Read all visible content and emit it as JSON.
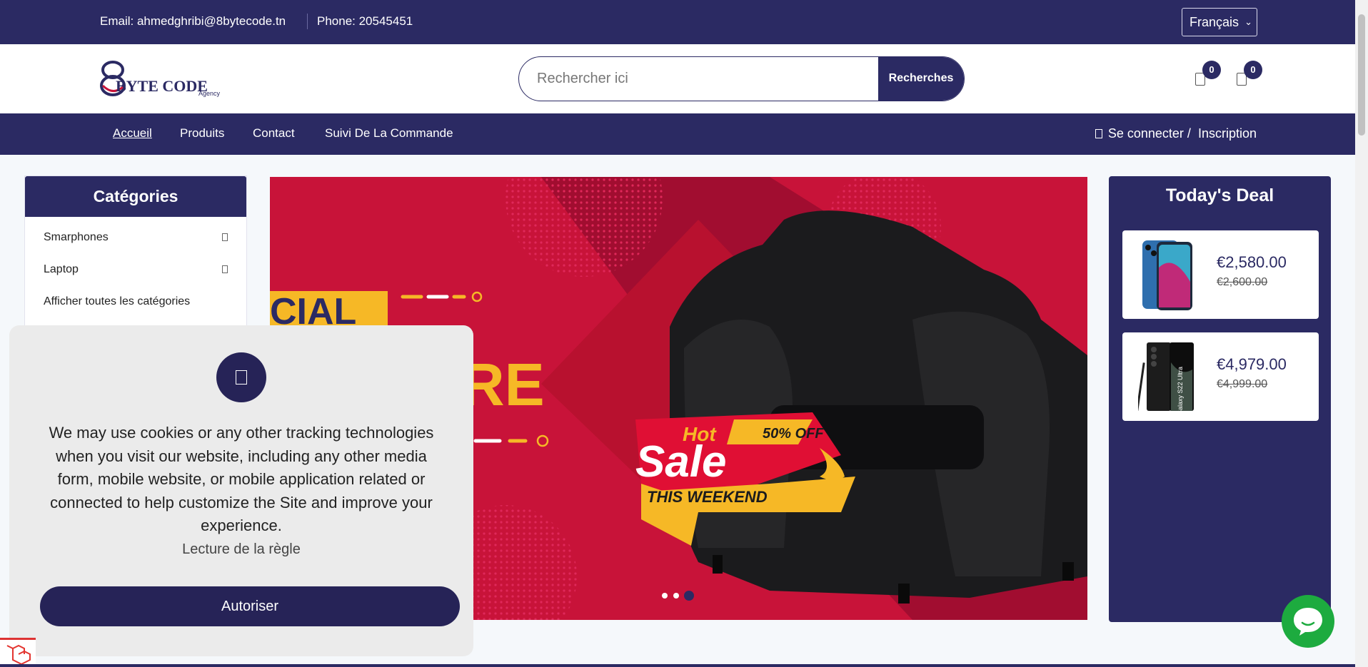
{
  "topbar": {
    "email_text": "Email: ahmedghribi@8bytecode.tn",
    "phone_text": "Phone: 20545451",
    "language": "Français"
  },
  "header": {
    "logo_text": "BYTE CODE",
    "logo_sub": "Agency",
    "search_placeholder": "Rechercher ici",
    "search_button": "Recherches",
    "wishlist_count": "0",
    "cart_count": "0"
  },
  "nav": {
    "items": [
      "Accueil",
      "Produits",
      "Contact",
      "Suivi De La Commande"
    ],
    "login": "Se connecter /",
    "register": "Inscription"
  },
  "categories": {
    "title": "Catégories",
    "items": [
      "Smarphones",
      "Laptop"
    ],
    "show_all": "Afficher toutes les catégories"
  },
  "banner": {
    "text_partial_1": "CIAL",
    "text_partial_2": "RE",
    "badge_hot": "Hot",
    "badge_sale": "Sale",
    "badge_off": "50% OFF",
    "badge_weekend": "THIS WEEKEND",
    "slide_count": 3,
    "active_slide": 3
  },
  "deal": {
    "title": "Today's Deal",
    "items": [
      {
        "price": "€2,580.00",
        "old_price": "€2,600.00",
        "icon": "iphone-image"
      },
      {
        "price": "€4,979.00",
        "old_price": "€4,999.00",
        "icon": "galaxy-s22-ultra-image",
        "image_text": "Galaxy S22 Ultra"
      }
    ]
  },
  "cookie": {
    "text": "We may use cookies or any other tracking technologies when you visit our website, including any other media form, mobile website, or mobile application related or connected to help customize the Site and improve your experience.",
    "policy_link": "Lecture de la règle",
    "allow_button": "Autoriser"
  },
  "colors": {
    "brand": "#2b2a63",
    "banner_red": "#c81339",
    "accent_yellow": "#f6b826",
    "chat_green": "#1dab3f"
  }
}
